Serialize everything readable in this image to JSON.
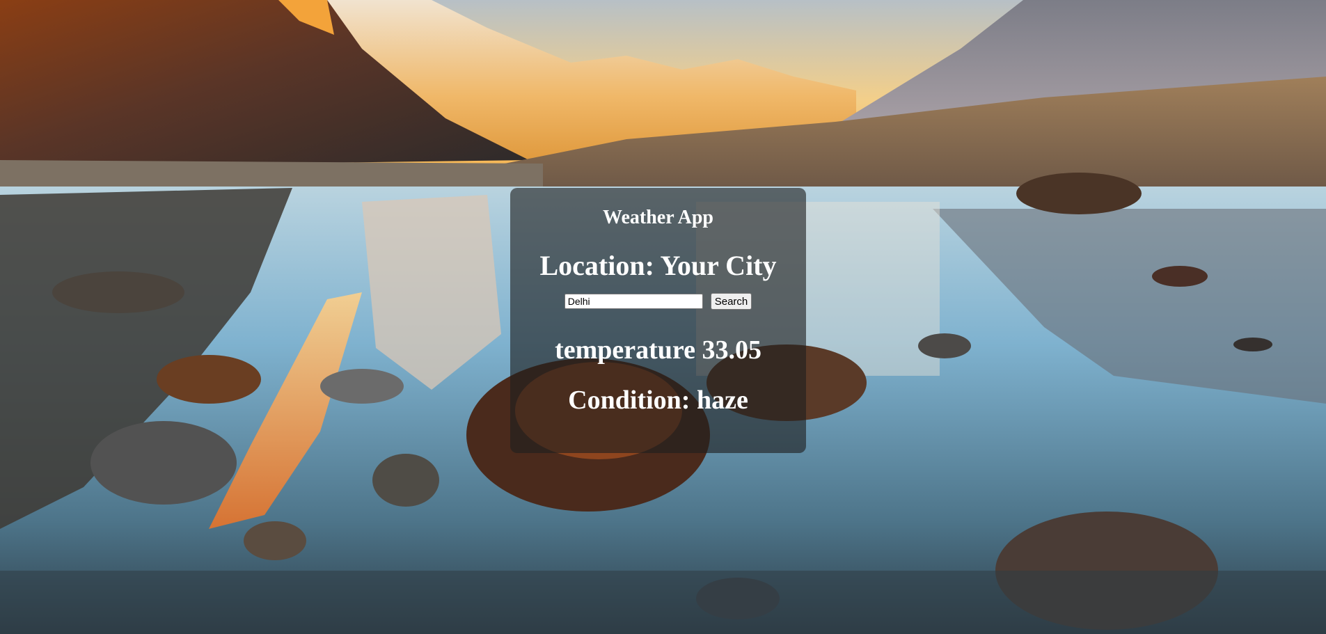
{
  "background": {
    "description_icon": "mountain-lake-sunrise-background",
    "sky_colors": [
      "#f7d58a",
      "#b9c4cf"
    ],
    "water_colors": [
      "#9fc6de",
      "#4c6f86"
    ]
  },
  "card": {
    "title": "Weather App",
    "location": "Location: Your City",
    "search_value": "Delhi",
    "search_button": "Search",
    "temperature": "temperature 33.05",
    "condition": "Condition: haze"
  }
}
